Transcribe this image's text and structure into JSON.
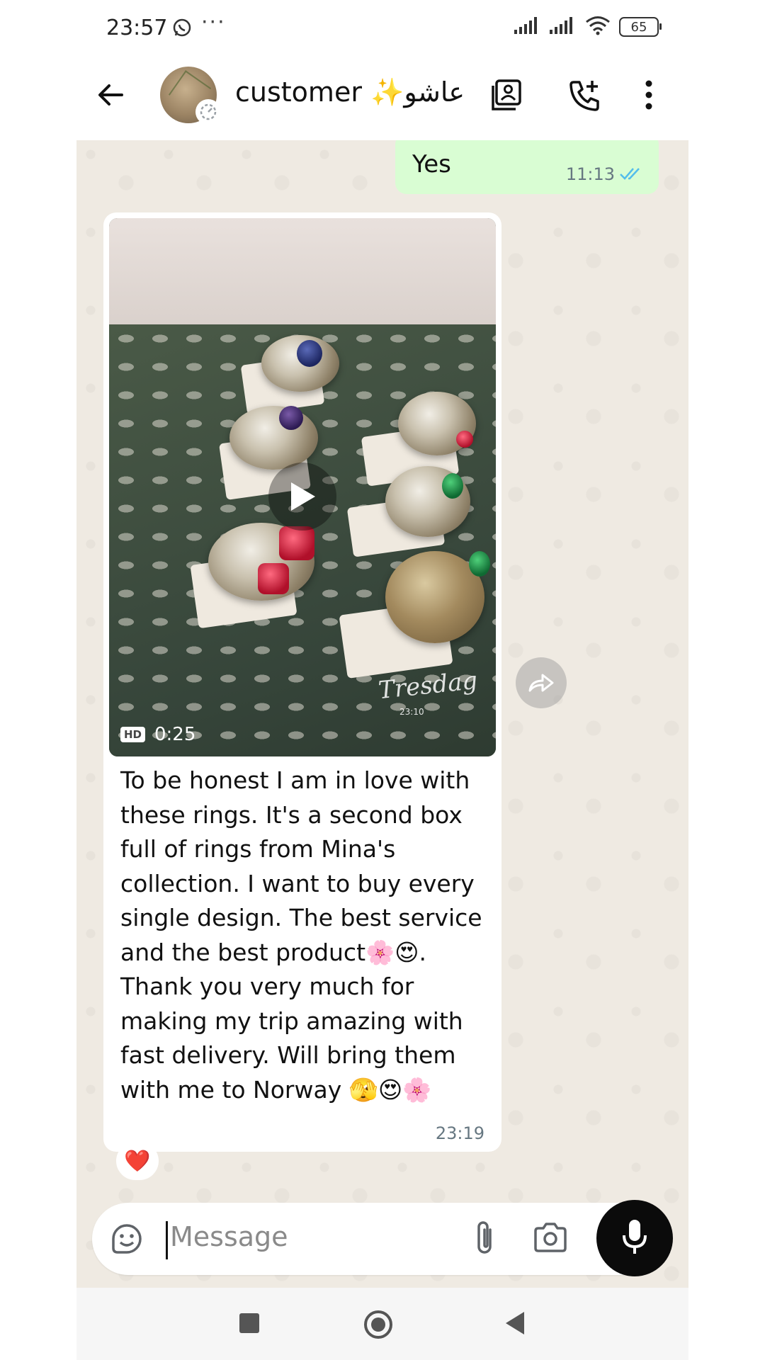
{
  "status_bar": {
    "time": "23:57",
    "extra": "···",
    "battery": "65",
    "icons": [
      "whatsapp-icon",
      "signal-icon",
      "signal-icon",
      "wifi-icon",
      "battery-icon"
    ]
  },
  "header": {
    "contact_name": "customer ✨عاشو",
    "icons": [
      "back-arrow-icon",
      "contact-card-icon",
      "add-call-icon",
      "more-vert-icon"
    ]
  },
  "messages": {
    "outgoing": {
      "text": "Yes",
      "time": "11:13"
    },
    "incoming": {
      "video_quality": "HD",
      "video_duration": "0:25",
      "watermark_signature": "Tresdag",
      "watermark_time": "23:10",
      "caption": "To be honest I am in love with these rings. It's a second box full of rings from Mina's collection. I want to buy every single design. The best service and the best product🌸😍. Thank you very much for making my trip amazing with fast delivery. Will bring them with me to Norway 🫣😍🌸",
      "time": "23:19",
      "reaction": "❤️"
    }
  },
  "composer": {
    "placeholder": "Message"
  },
  "colors": {
    "chat_bg": "#efeae2",
    "outgoing_bubble": "#d9fdd3",
    "incoming_bubble": "#ffffff",
    "read_ticks": "#53bdeb",
    "mic_button": "#0b0b0b"
  }
}
